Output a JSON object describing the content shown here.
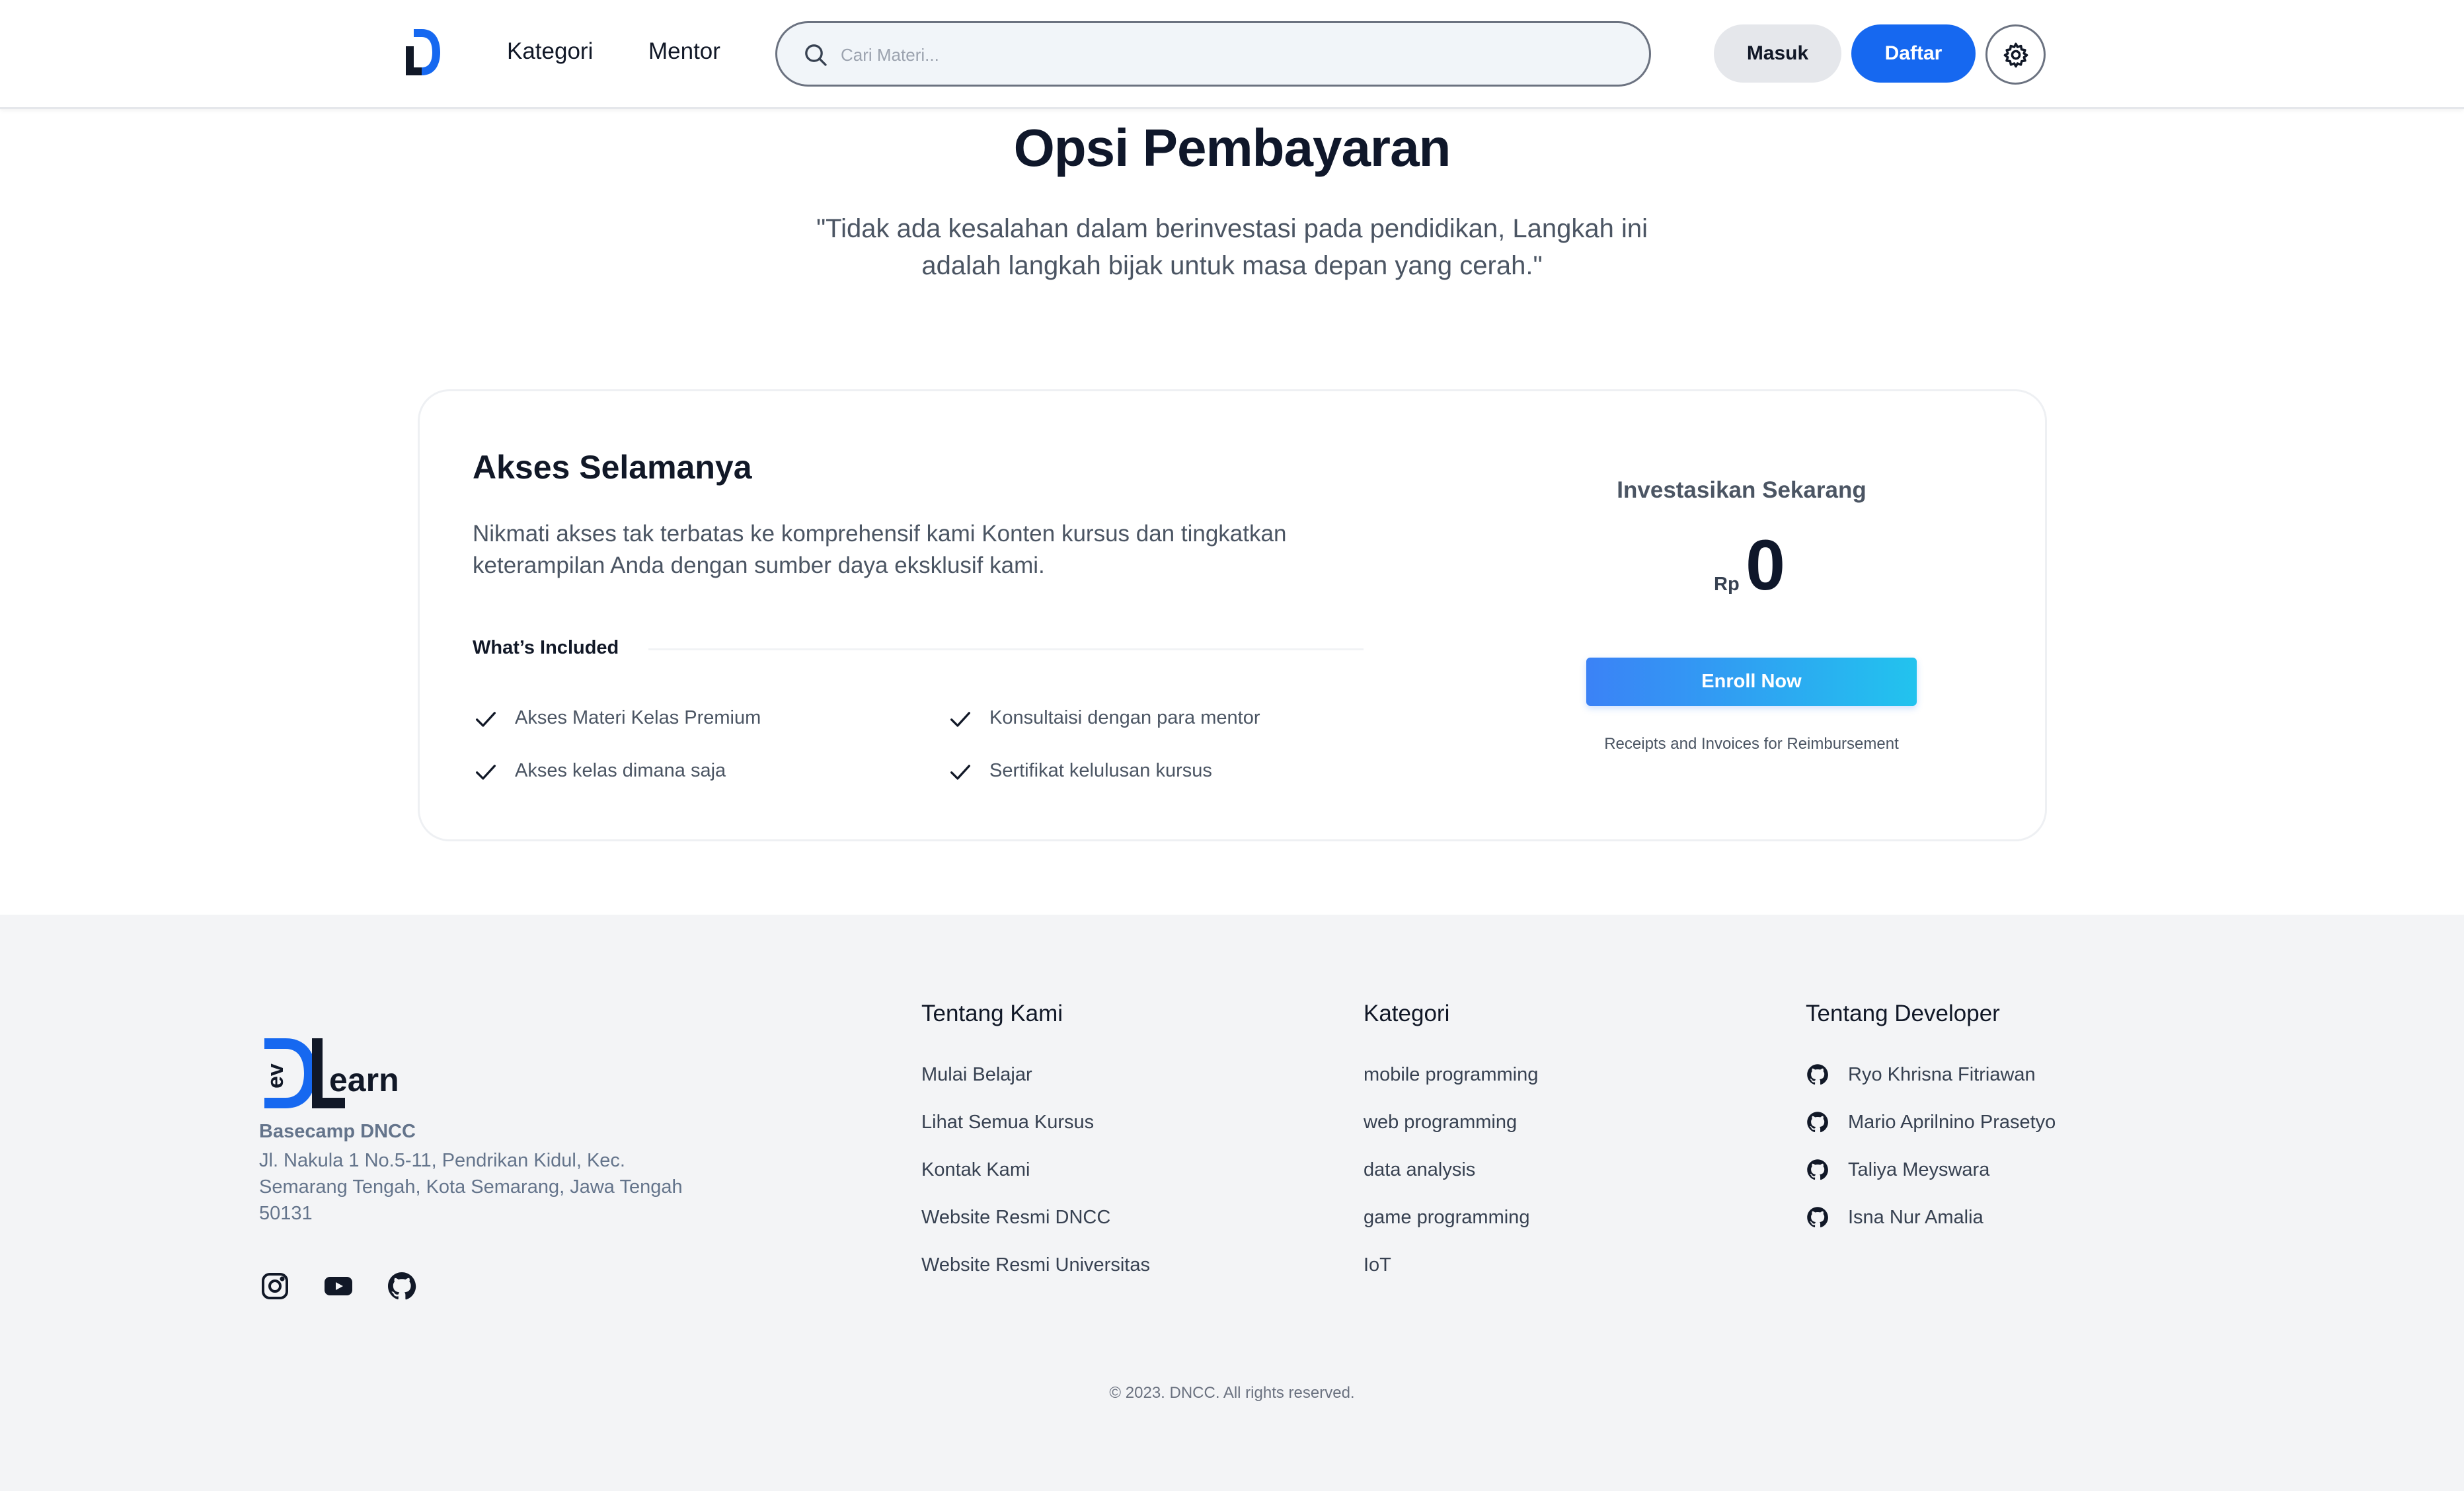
{
  "nav": {
    "logo_letter": "D",
    "links": [
      "Kategori",
      "Mentor"
    ],
    "search_placeholder": "Cari Materi...",
    "login_label": "Masuk",
    "register_label": "Daftar",
    "theme_icon": "gear-icon"
  },
  "hero": {
    "title": "Opsi Pembayaran",
    "quote_line1": "\"Tidak ada kesalahan dalam berinvestasi pada pendidikan, Langkah ini",
    "quote_line2": "adalah langkah bijak untuk masa depan yang cerah.\""
  },
  "plan": {
    "title": "Akses Selamanya",
    "description": "Nikmati akses tak terbatas ke komprehensif kami Konten kursus dan tingkatkan keterampilan Anda dengan sumber daya eksklusif kami.",
    "included_label": "What’s Included",
    "features": [
      "Akses Materi Kelas Premium",
      "Konsultaisi dengan para mentor",
      "Akses kelas dimana saja",
      "Sertifikat kelulusan kursus"
    ],
    "invest_label": "Investasikan Sekarang",
    "currency": "Rp",
    "price": "0",
    "enroll_label": "Enroll Now",
    "receipts_note": "Receipts and Invoices for Reimbursement"
  },
  "footer": {
    "logo_text": "earn",
    "logo_small": "ev",
    "org_name": "Basecamp DNCC",
    "address": "Jl. Nakula 1 No.5-11, Pendrikan Kidul, Kec. Semarang Tengah, Kota Semarang, Jawa Tengah 50131",
    "socials": [
      "instagram-icon",
      "youtube-icon",
      "github-icon"
    ],
    "about": {
      "title": "Tentang Kami",
      "links": [
        "Mulai Belajar",
        "Lihat Semua Kursus",
        "Kontak Kami",
        "Website Resmi DNCC",
        "Website Resmi Universitas"
      ]
    },
    "categories": {
      "title": "Kategori",
      "links": [
        "mobile programming",
        "web programming",
        "data analysis",
        "game programming",
        "IoT"
      ]
    },
    "developers": {
      "title": "Tentang Developer",
      "names": [
        "Ryo Khrisna Fitriawan",
        "Mario Aprilnino Prasetyo",
        "Taliya Meyswara",
        "Isna Nur Amalia"
      ]
    },
    "copyright": "© 2023. DNCC. All rights reserved."
  },
  "colors": {
    "primary": "#1668f0",
    "gradient_start": "#3b82f6",
    "gradient_end": "#22c3ee",
    "footer_bg": "#f3f4f6"
  }
}
